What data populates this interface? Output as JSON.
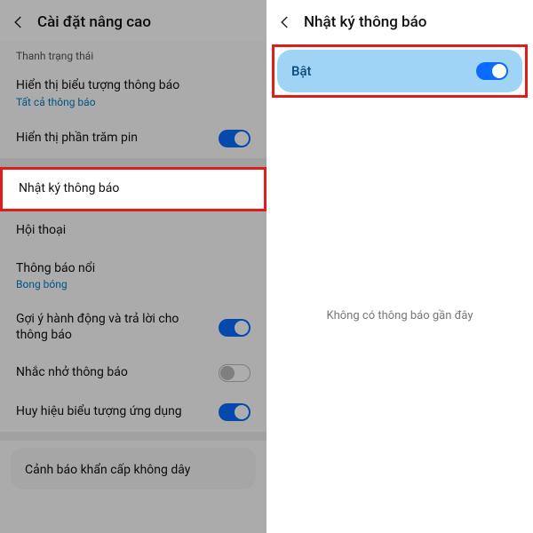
{
  "left": {
    "headerTitle": "Cài đặt nâng cao",
    "sectionLabel": "Thanh trạng thái",
    "rows": {
      "iconDisplay": {
        "title": "Hiển thị biểu tượng thông báo",
        "sub": "Tất cả thông báo"
      },
      "batteryPct": {
        "title": "Hiển thị phần trăm pin"
      },
      "notifLog": {
        "title": "Nhật ký thông báo"
      },
      "conversation": {
        "title": "Hội thoại"
      },
      "floating": {
        "title": "Thông báo nổi",
        "sub": "Bong bóng"
      },
      "suggest": {
        "title": "Gợi ý hành động và trả lời cho thông báo"
      },
      "reminder": {
        "title": "Nhắc nhở thông báo"
      },
      "badge": {
        "title": "Huy hiệu biểu tượng ứng dụng"
      },
      "emergency": {
        "title": "Cảnh báo khẩn cấp không dây"
      }
    }
  },
  "right": {
    "headerTitle": "Nhật ký thông báo",
    "toggleLabel": "Bật",
    "emptyMessage": "Không có thông báo gần đây"
  }
}
